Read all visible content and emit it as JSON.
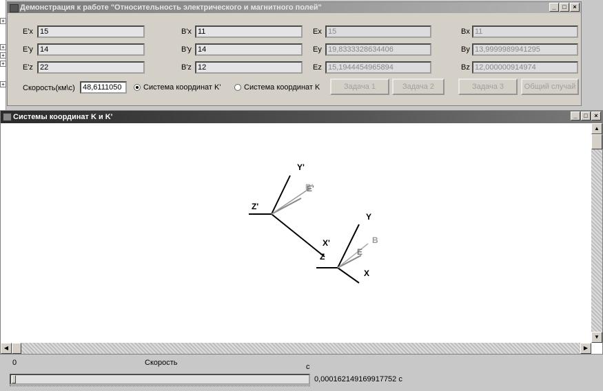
{
  "main_window": {
    "title": "Демонстрация к работе \"Относительность электрического и магнитного полей\"",
    "controls": [
      "_",
      "□",
      "×"
    ]
  },
  "fields": {
    "ex_prime": {
      "label": "E'x",
      "value": "15"
    },
    "ey_prime": {
      "label": "E'y",
      "value": "14"
    },
    "ez_prime": {
      "label": "E'z",
      "value": "22"
    },
    "bx_prime": {
      "label": "B'x",
      "value": "11"
    },
    "by_prime": {
      "label": "B'y",
      "value": "14"
    },
    "bz_prime": {
      "label": "B'z",
      "value": "12"
    },
    "ex": {
      "label": "Ex",
      "value": "15"
    },
    "ey": {
      "label": "Ey",
      "value": "19,8333328634406"
    },
    "ez": {
      "label": "Ez",
      "value": "15,1944454965894"
    },
    "bx": {
      "label": "Bx",
      "value": "11"
    },
    "by": {
      "label": "By",
      "value": "13,9999989941295"
    },
    "bz": {
      "label": "Bz",
      "value": "12,000000914974"
    }
  },
  "speed": {
    "label": "Скорость(км\\с)",
    "value": "48,6111050"
  },
  "radios": {
    "k_prime": {
      "label": "Система координат K'",
      "selected": true
    },
    "k": {
      "label": "Система координат K",
      "selected": false
    }
  },
  "buttons": {
    "task1": "Задача 1",
    "task2": "Задача 2",
    "task3": "Задача 3",
    "general": "Общий случай"
  },
  "coord_window": {
    "title": "Системы координат K и K'",
    "controls": [
      "_",
      "□",
      "×"
    ],
    "axes_prime": {
      "y": "Y'",
      "z": "Z'",
      "x": "X'",
      "e": "E'",
      "b": "B'"
    },
    "axes": {
      "y": "Y",
      "z": "Z",
      "x": "X",
      "e": "E",
      "b": "B"
    }
  },
  "bottom": {
    "zero": "0",
    "speed_label": "Скорость",
    "c_label": "c",
    "time_value": "0,000162149169917752 c",
    "slider_fraction": 0
  }
}
